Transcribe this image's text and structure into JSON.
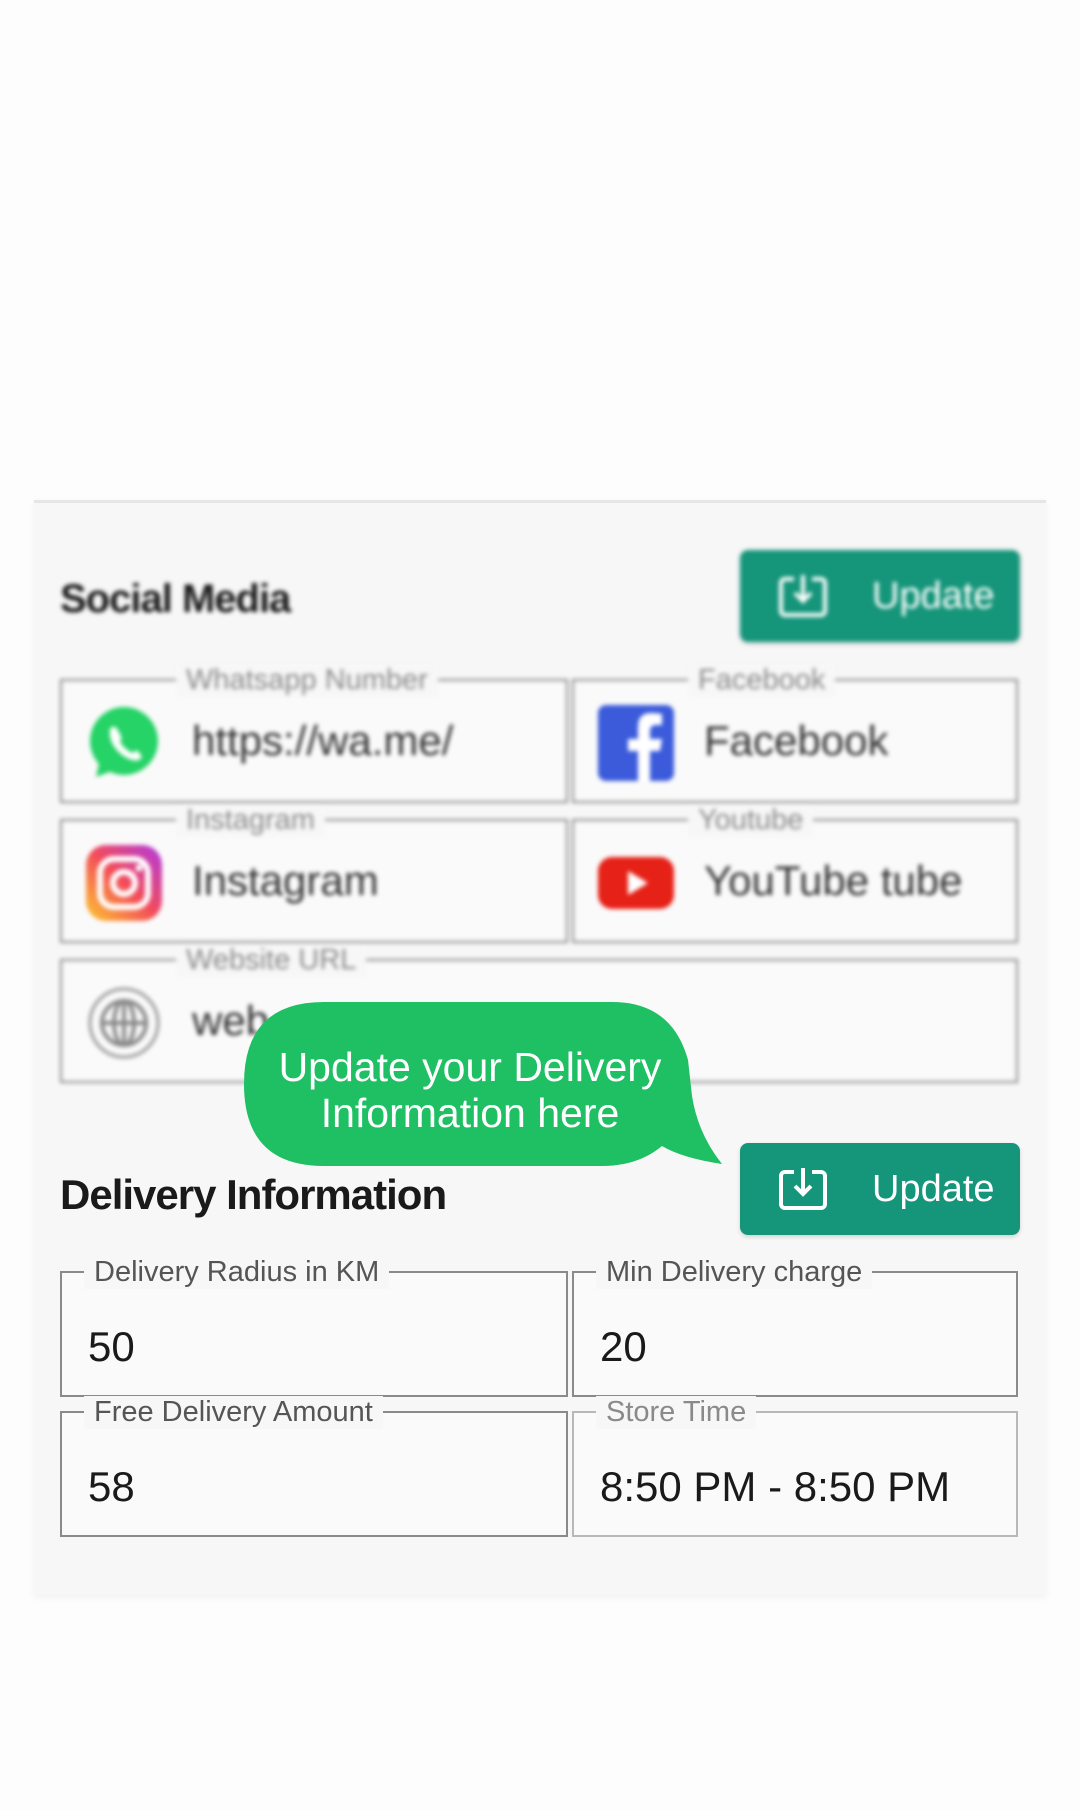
{
  "social_media": {
    "title": "Social Media",
    "update_label": "Update",
    "fields": [
      {
        "label": "Whatsapp Number",
        "value": "https://wa.me/",
        "icon": "whatsapp-icon"
      },
      {
        "label": "Facebook",
        "value": "Facebook",
        "icon": "facebook-icon"
      },
      {
        "label": "Instagram",
        "value": "Instagram",
        "icon": "instagram-icon"
      },
      {
        "label": "Youtube",
        "value": "YouTube tube",
        "icon": "youtube-icon"
      },
      {
        "label": "Website URL",
        "value": "web",
        "icon": "globe-icon"
      }
    ]
  },
  "tooltip": {
    "line1": "Update your Delivery",
    "line2": "Information here"
  },
  "delivery": {
    "title": "Delivery Information",
    "update_label": "Update",
    "fields": [
      {
        "label": "Delivery Radius in KM",
        "value": "50"
      },
      {
        "label": "Min Delivery charge",
        "value": "20"
      },
      {
        "label": "Free Delivery Amount",
        "value": "58"
      },
      {
        "label": "Store Time",
        "value": "8:50 PM - 8:50 PM"
      }
    ]
  },
  "colors": {
    "accent": "#15957a",
    "tooltip": "#1fbf63",
    "whatsapp": "#25d366",
    "facebook": "#3b5bdb",
    "youtube": "#e62117"
  }
}
